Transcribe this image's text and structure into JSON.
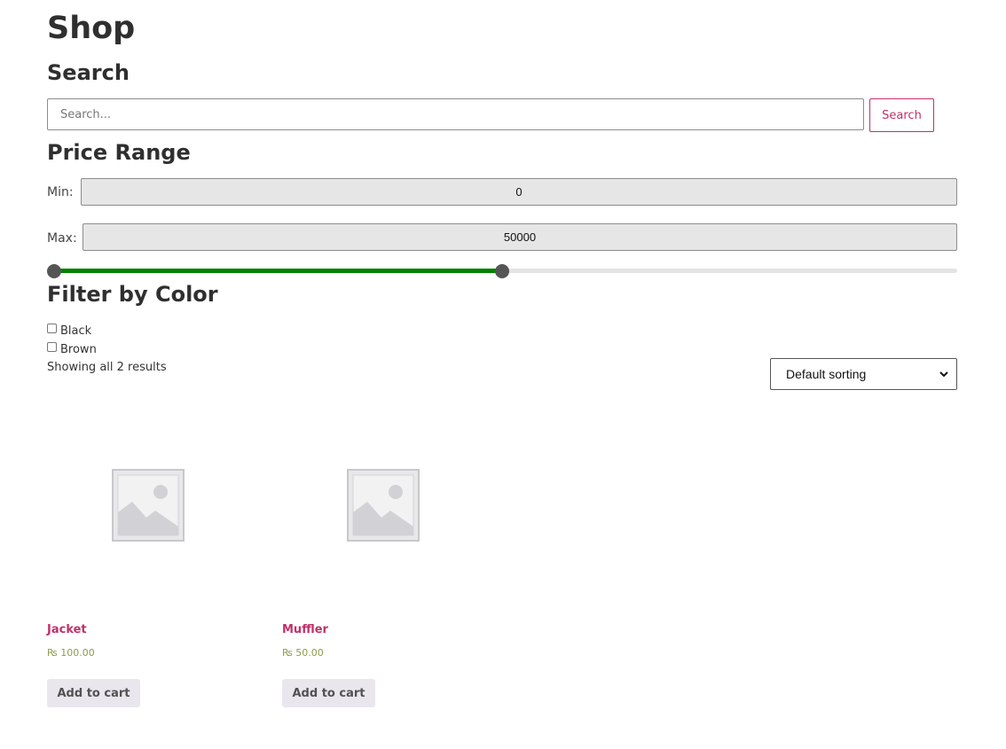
{
  "page": {
    "title": "Shop"
  },
  "search": {
    "heading": "Search",
    "placeholder": "Search...",
    "button_label": "Search"
  },
  "price_range": {
    "heading": "Price Range",
    "min_label": "Min:",
    "min_value": "0",
    "max_label": "Max:",
    "max_value": "50000",
    "slider": {
      "low_fraction": 0.0,
      "high_fraction": 0.5,
      "fill_color": "#008000"
    }
  },
  "color_filter": {
    "heading": "Filter by Color",
    "options": [
      {
        "label": "Black",
        "checked": false
      },
      {
        "label": "Brown",
        "checked": false
      }
    ]
  },
  "results": {
    "count_text": "Showing all 2 results",
    "sort_selected": "Default sorting"
  },
  "products": [
    {
      "name": "Jacket",
      "price": "₨ 100.00",
      "button_label": "Add to cart",
      "image_icon": "placeholder-image-icon"
    },
    {
      "name": "Muffler",
      "price": "₨ 50.00",
      "button_label": "Add to cart",
      "image_icon": "placeholder-image-icon"
    }
  ],
  "colors": {
    "accent": "#c0306a",
    "price": "#8f9b48",
    "button_bg": "#e9e6ed"
  }
}
